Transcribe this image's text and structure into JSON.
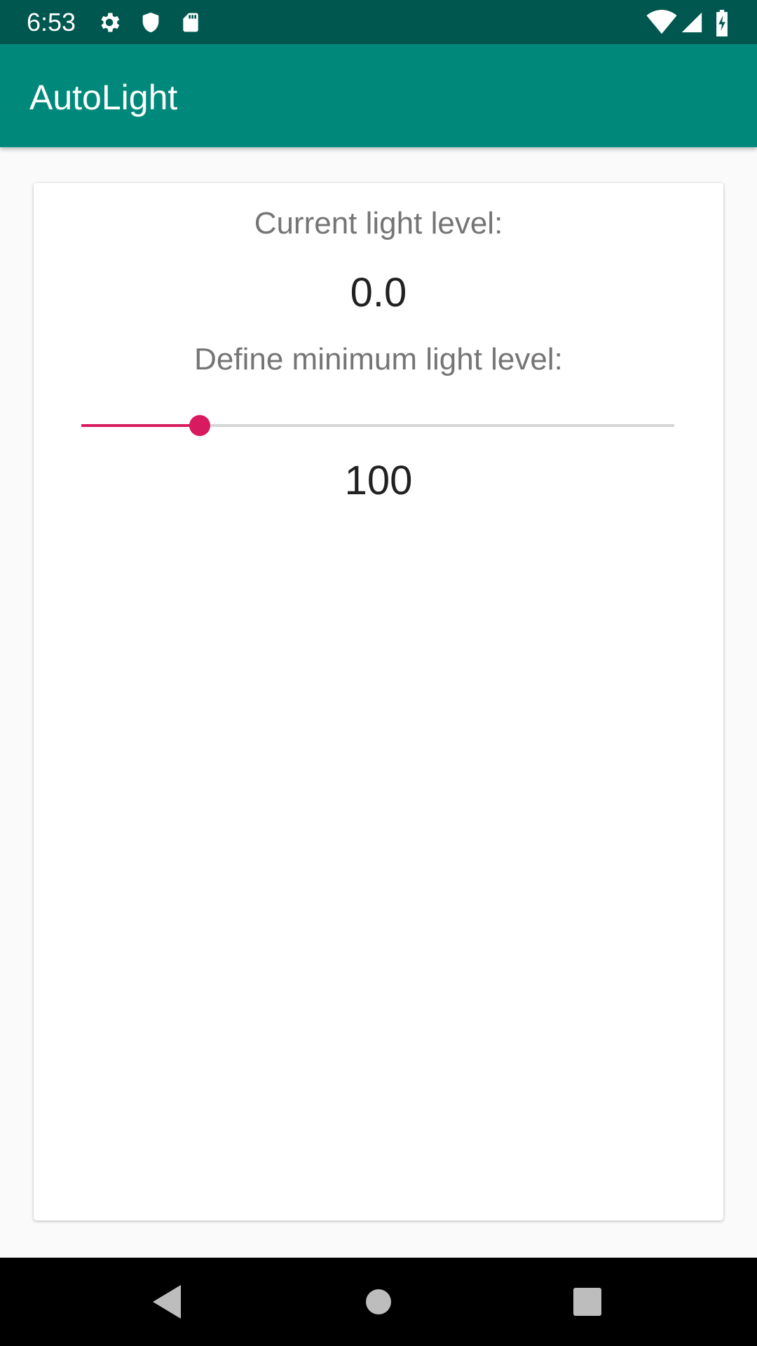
{
  "status_bar": {
    "time": "6:53",
    "icons": [
      "settings-icon",
      "shield-icon",
      "sd-card-icon",
      "wifi-icon",
      "signal-icon",
      "battery-charging-icon"
    ]
  },
  "app_bar": {
    "title": "AutoLight"
  },
  "main": {
    "current_light_label": "Current light level:",
    "current_light_value": "0.0",
    "min_light_label": "Define minimum light level:",
    "min_light_value": "100",
    "slider_fraction": 0.2
  },
  "nav_bar": {
    "icons": [
      "back-icon",
      "home-icon",
      "recents-icon"
    ]
  },
  "colors": {
    "status_bar": "#00574f",
    "app_bar": "#00897b",
    "accent": "#d81b60",
    "background": "#fafafa"
  }
}
